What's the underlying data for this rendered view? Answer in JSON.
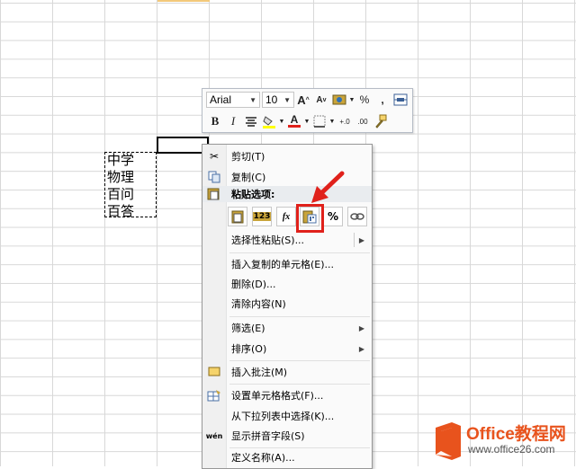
{
  "sheet": {
    "cells": [
      "中学",
      "物理",
      "百问",
      "百答"
    ]
  },
  "mini_toolbar": {
    "font_name": "Arial",
    "font_size": "10",
    "grow_font": "A",
    "shrink_font": "A",
    "percent": "%",
    "comma": ",",
    "bold": "B",
    "italic": "I",
    "font_color_letter": "A",
    "dec_increase": "+.0",
    "dec_decrease": ".00"
  },
  "menu": {
    "cut": "剪切(T)",
    "copy": "复制(C)",
    "paste_options_header": "粘贴选项:",
    "paste_buttons": [
      "",
      "123",
      "fx",
      "",
      "%",
      ""
    ],
    "paste_special": "选择性粘贴(S)...",
    "insert_copied": "插入复制的单元格(E)...",
    "delete": "删除(D)...",
    "clear": "清除内容(N)",
    "filter": "筛选(E)",
    "sort": "排序(O)",
    "insert_comment": "插入批注(M)",
    "format_cells": "设置单元格格式(F)...",
    "pick_from_list": "从下拉列表中选择(K)...",
    "phonetic": "显示拼音字段(S)",
    "define_name": "定义名称(A)..."
  },
  "watermark": {
    "brand": "Office教程网",
    "url": "www.office26.com"
  },
  "colors": {
    "accent_red": "#e0211b",
    "logo_orange": "#e8531d"
  }
}
